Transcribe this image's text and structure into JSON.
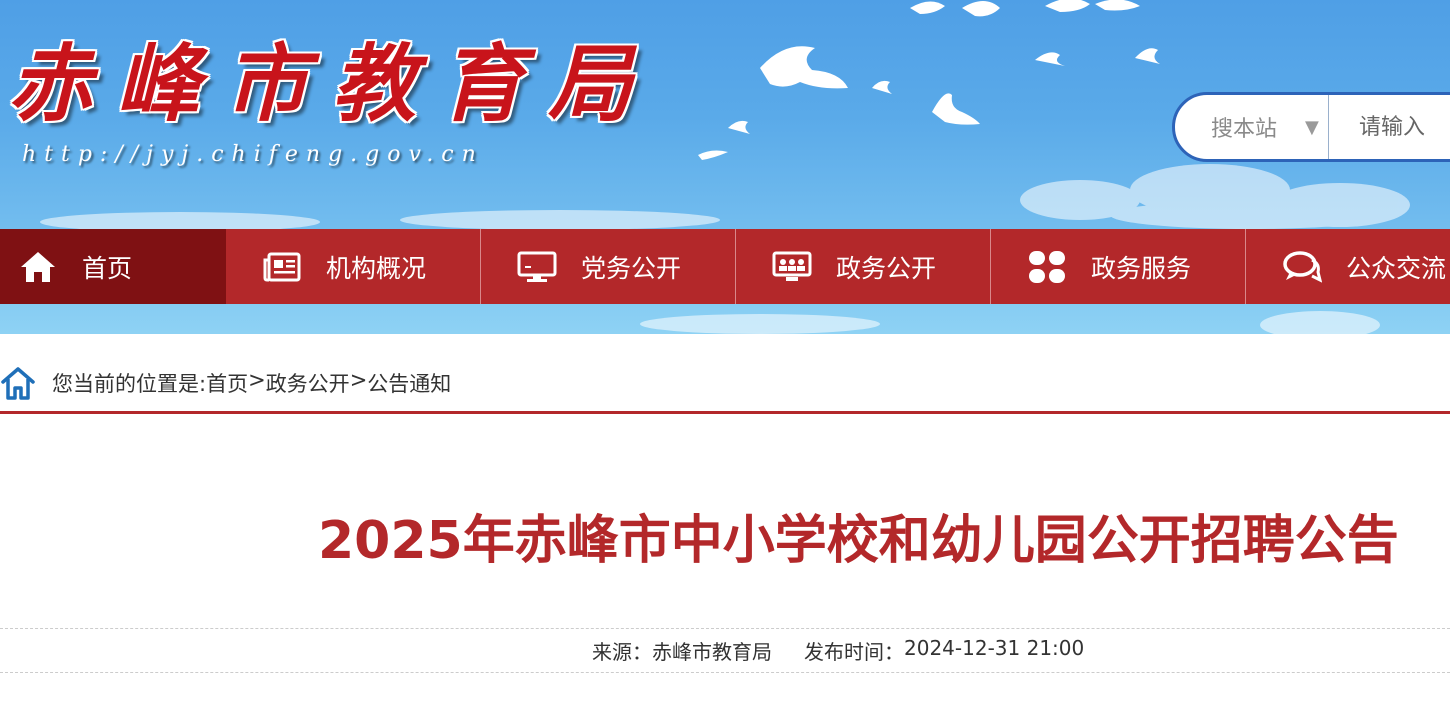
{
  "header": {
    "site_title": "赤峰市教育局",
    "site_url": "http://jyj.chifeng.gov.cn",
    "colors": {
      "sky": "#5aaae9",
      "title_red": "#c8141b",
      "nav_red": "#b3282a",
      "nav_active": "#7f1113"
    }
  },
  "search": {
    "scope_label": "搜本站",
    "scope_arrow": "▼",
    "placeholder": "请输入"
  },
  "nav": {
    "items": [
      {
        "label": "首页",
        "icon": "home-icon",
        "active": true
      },
      {
        "label": "机构概况",
        "icon": "newspaper-icon"
      },
      {
        "label": "党务公开",
        "icon": "monitor-icon"
      },
      {
        "label": "政务公开",
        "icon": "presentation-icon"
      },
      {
        "label": "政务服务",
        "icon": "grid-icon"
      },
      {
        "label": "公众交流",
        "icon": "chat-icon"
      }
    ]
  },
  "breadcrumb": {
    "prefix": "您当前的位置是:",
    "items": [
      "首页",
      "政务公开",
      "公告通知"
    ],
    "separator": ">"
  },
  "article": {
    "title": "2025年赤峰市中小学校和幼儿园公开招聘公告",
    "source_label": "来源：",
    "source": "赤峰市教育局",
    "published_label": "发布时间：",
    "published": "2024-12-31 21:00"
  }
}
